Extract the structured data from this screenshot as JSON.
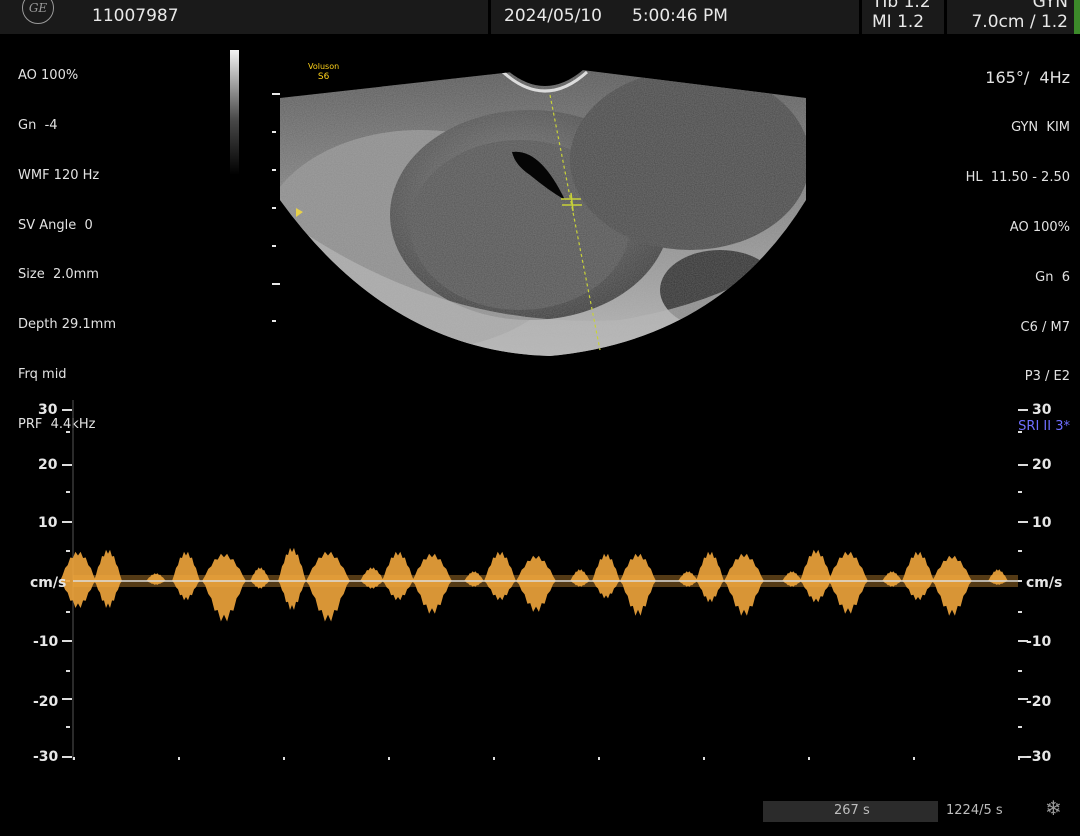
{
  "header": {
    "logo": "GE",
    "patient_id": "11007987",
    "date": "2024/05/10",
    "time": "5:00:46 PM",
    "tib": "TIb  1.2",
    "mi": "MI  1.2",
    "preset": "GYN",
    "depth_freq": "7.0cm / 1.2"
  },
  "left_params": [
    "AO 100%",
    "Gn  -4",
    "WMF 120 Hz",
    "SV Angle  0",
    "Size  2.0mm",
    "Depth 29.1mm",
    "Frq mid",
    "PRF  4.4kHz"
  ],
  "right_params": [
    "165°/  4Hz",
    "GYN  KIM",
    "HL  11.50 - 2.50",
    "AO 100%",
    "Gn  6",
    "C6 / M7",
    "P3 / E2",
    "SRI II 3*"
  ],
  "probe": {
    "brand": "Voluson",
    "model": "S6"
  },
  "spectrum": {
    "unit": "cm/s",
    "scale_left": [
      "30",
      "20",
      "10",
      "-10",
      "-20",
      "-30"
    ],
    "scale_right": [
      "30",
      "20",
      "10",
      "-10",
      "-20",
      "-30"
    ],
    "color": "#f0a53c",
    "baseline_color": "#dcdcdc"
  },
  "status": {
    "duration": "267 s",
    "frames": "1224/5 s"
  },
  "icons": {
    "freeze": "snowflake-icon",
    "logo": "ge-logo-icon"
  }
}
